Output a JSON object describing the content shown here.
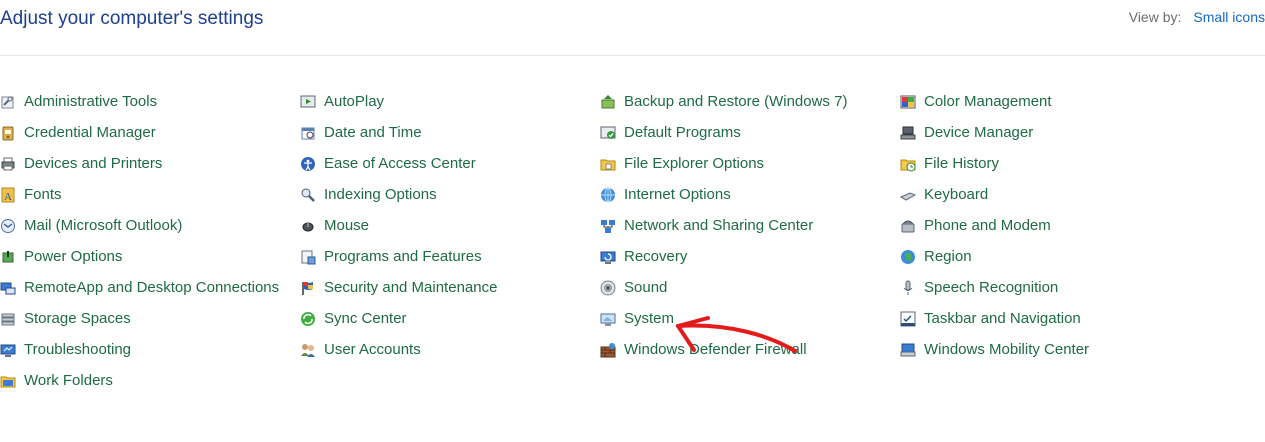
{
  "header": {
    "title": "Adjust your computer's settings",
    "view_by_label": "View by:",
    "view_by_value": "Small icons"
  },
  "columns": [
    {
      "items": [
        {
          "label": "Administrative Tools",
          "icon": "administrative-tools-icon"
        },
        {
          "label": "Credential Manager",
          "icon": "credential-manager-icon"
        },
        {
          "label": "Devices and Printers",
          "icon": "printer-icon"
        },
        {
          "label": "Fonts",
          "icon": "fonts-icon"
        },
        {
          "label": "Mail (Microsoft Outlook)",
          "icon": "mail-icon"
        },
        {
          "label": "Power Options",
          "icon": "power-options-icon"
        },
        {
          "label": "RemoteApp and Desktop Connections",
          "icon": "remote-desktop-icon"
        },
        {
          "label": "Storage Spaces",
          "icon": "storage-spaces-icon"
        },
        {
          "label": "Troubleshooting",
          "icon": "troubleshooting-icon"
        },
        {
          "label": "Work Folders",
          "icon": "work-folders-icon"
        }
      ]
    },
    {
      "items": [
        {
          "label": "AutoPlay",
          "icon": "autoplay-icon"
        },
        {
          "label": "Date and Time",
          "icon": "date-time-icon"
        },
        {
          "label": "Ease of Access Center",
          "icon": "ease-of-access-icon"
        },
        {
          "label": "Indexing Options",
          "icon": "indexing-icon"
        },
        {
          "label": "Mouse",
          "icon": "mouse-icon"
        },
        {
          "label": "Programs and Features",
          "icon": "programs-features-icon"
        },
        {
          "label": "Security and Maintenance",
          "icon": "security-flag-icon"
        },
        {
          "label": "Sync Center",
          "icon": "sync-icon"
        },
        {
          "label": "User Accounts",
          "icon": "user-accounts-icon"
        }
      ]
    },
    {
      "items": [
        {
          "label": "Backup and Restore (Windows 7)",
          "icon": "backup-icon"
        },
        {
          "label": "Default Programs",
          "icon": "default-programs-icon"
        },
        {
          "label": "File Explorer Options",
          "icon": "folder-options-icon"
        },
        {
          "label": "Internet Options",
          "icon": "internet-options-icon"
        },
        {
          "label": "Network and Sharing Center",
          "icon": "network-icon"
        },
        {
          "label": "Recovery",
          "icon": "recovery-icon"
        },
        {
          "label": "Sound",
          "icon": "sound-icon"
        },
        {
          "label": "System",
          "icon": "system-icon"
        },
        {
          "label": "Windows Defender Firewall",
          "icon": "firewall-icon"
        }
      ]
    },
    {
      "items": [
        {
          "label": "Color Management",
          "icon": "color-management-icon"
        },
        {
          "label": "Device Manager",
          "icon": "device-manager-icon"
        },
        {
          "label": "File History",
          "icon": "file-history-icon"
        },
        {
          "label": "Keyboard",
          "icon": "keyboard-icon"
        },
        {
          "label": "Phone and Modem",
          "icon": "phone-modem-icon"
        },
        {
          "label": "Region",
          "icon": "region-globe-icon"
        },
        {
          "label": "Speech Recognition",
          "icon": "microphone-icon"
        },
        {
          "label": "Taskbar and Navigation",
          "icon": "taskbar-icon"
        },
        {
          "label": "Windows Mobility Center",
          "icon": "mobility-center-icon"
        }
      ]
    }
  ],
  "annotation": {
    "type": "red-arrow",
    "points_to": "System",
    "color": "#e31b1b"
  },
  "colors": {
    "title": "#1e3f8f",
    "item_text": "#1e6b45",
    "link": "#1668c4",
    "muted": "#6d6d6d"
  }
}
